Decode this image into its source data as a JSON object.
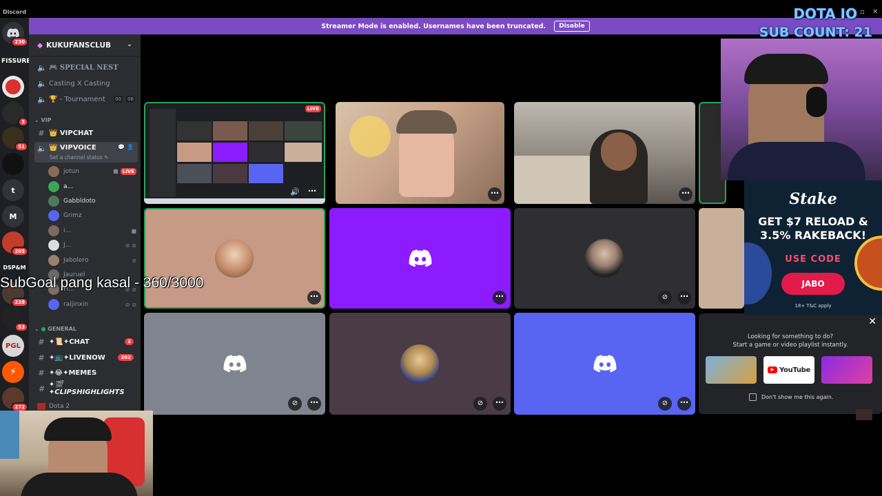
{
  "app": {
    "title": "Discord"
  },
  "banner": {
    "message": "Streamer Mode is enabled. Usernames have been truncated.",
    "disable_label": "Disable"
  },
  "overlay": {
    "line1": "DOTA IO",
    "line2": "SUB COUNT: 21",
    "subgoal": "SubGoal pang kasal - 360/3000"
  },
  "server_rail": {
    "home_badge": "230",
    "items": [
      {
        "label": "FISSURE"
      },
      {
        "badge": "3"
      },
      {
        "badge": "51"
      },
      {
        "label": "t"
      },
      {
        "label": "M"
      },
      {
        "badge": "205"
      },
      {
        "label": "DSP&M"
      },
      {
        "badge": "228"
      },
      {
        "badge": "53"
      },
      {
        "label": "PGL"
      },
      {
        "badge": "272"
      }
    ]
  },
  "sidebar": {
    "server_name": "KUKUFANSCLUB",
    "channels_top": [
      {
        "label": "🎮 SPECIAL NEST"
      },
      {
        "label": "Casting X Casting"
      },
      {
        "label": "🏆 - Tournament",
        "count1": "00",
        "count2": "06"
      }
    ],
    "category_vip": "VIP",
    "vipchat": "👑 VIPCHAT",
    "vipvoice": "👑 VIPVOICE",
    "channel_status": "Set a channel status ✎",
    "voice_users": [
      {
        "name": "jotun",
        "live": "LIVE"
      },
      {
        "name": "a..."
      },
      {
        "name": "Gabbldoto"
      },
      {
        "name": "Grimz"
      },
      {
        "name": "i..."
      },
      {
        "name": "J..."
      },
      {
        "name": "Jabolero"
      },
      {
        "name": "Jauruel"
      },
      {
        "name": "Fi..."
      },
      {
        "name": "raijinxin"
      }
    ],
    "category_general": "GENERAL",
    "general_channels": [
      {
        "label": "✦📜✦CHAT",
        "badge": "2"
      },
      {
        "label": "✦📺✦LIVENOW",
        "badge": "202"
      },
      {
        "label": "✦😂✦MEMES"
      },
      {
        "label": "✦🎬✦CLIPSHIGHLIGHTS"
      }
    ],
    "dota_channel": "Dota 2"
  },
  "grid": {
    "live_label": "LIVE",
    "dots": "⋯"
  },
  "stake": {
    "logo": "Stake",
    "headline_1": "GET $7 RELOAD &",
    "headline_2": "3.5% RAKEBACK!",
    "use_code": "USE CODE",
    "code": "JABO",
    "terms": "18+ T&C apply"
  },
  "activity": {
    "line1": "Looking for something to do?",
    "line2": "Start a game or video playlist instantly.",
    "youtube": "YouTube",
    "dont_show": "Don't show me this again."
  },
  "colors": {
    "blurple": "#5865f2",
    "purple_tile": "#8c1bff",
    "speaking_green": "#23a55a",
    "banner": "#7a4bc3"
  }
}
